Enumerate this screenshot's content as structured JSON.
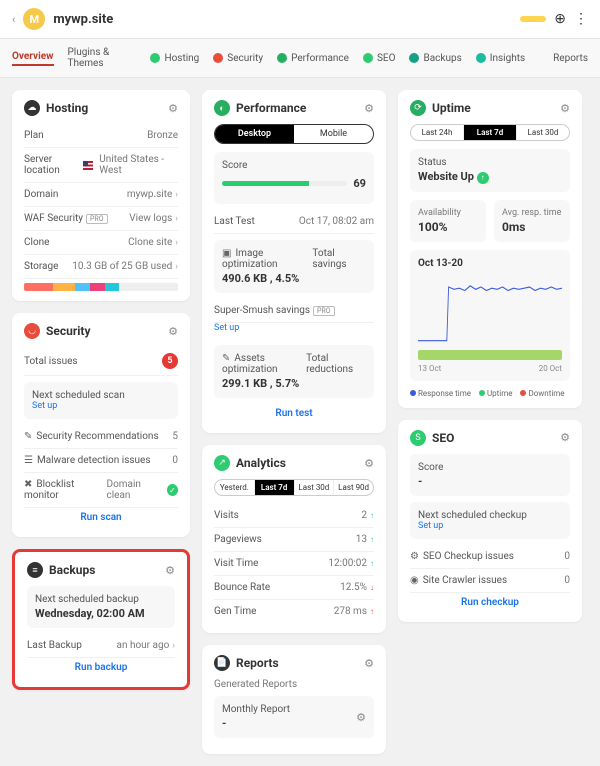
{
  "header": {
    "avatar": "M",
    "site": "mywp.site"
  },
  "tabs": {
    "overview": "Overview",
    "plugins": "Plugins & Themes",
    "hosting": "Hosting",
    "security": "Security",
    "performance": "Performance",
    "seo": "SEO",
    "backups": "Backups",
    "insights": "Insights",
    "reports": "Reports"
  },
  "hosting": {
    "title": "Hosting",
    "plan_l": "Plan",
    "plan_v": "Bronze",
    "loc_l": "Server location",
    "loc_v": "United States - West",
    "dom_l": "Domain",
    "dom_v": "mywp.site",
    "waf_l": "WAF Security",
    "waf_v": "View logs",
    "clone_l": "Clone",
    "clone_v": "Clone site",
    "stor_l": "Storage",
    "stor_v": "10.3 GB of 25 GB used"
  },
  "security": {
    "title": "Security",
    "issues_l": "Total issues",
    "issues_v": "5",
    "scan_l": "Next scheduled scan",
    "setup": "Set up",
    "rec_l": "Security Recommendations",
    "rec_v": "5",
    "mal_l": "Malware detection issues",
    "mal_v": "0",
    "block_l": "Blocklist monitor",
    "block_v": "Domain clean",
    "run": "Run scan"
  },
  "backups": {
    "title": "Backups",
    "next_l": "Next scheduled backup",
    "next_v": "Wednesday, 02:00 AM",
    "last_l": "Last Backup",
    "last_v": "an hour ago",
    "run": "Run backup"
  },
  "perf": {
    "title": "Performance",
    "desktop": "Desktop",
    "mobile": "Mobile",
    "score_l": "Score",
    "score_v": "69",
    "test_l": "Last Test",
    "test_v": "Oct 17, 08:02 am",
    "img_l": "Image optimization",
    "img_v": "490.6 KB , 4.5%",
    "img_r": "Total savings",
    "smush_l": "Super-Smush savings",
    "asset_l": "Assets optimization",
    "asset_v": "299.1 KB , 5.7%",
    "asset_r": "Total reductions",
    "run": "Run test",
    "setup": "Set up"
  },
  "analytics": {
    "title": "Analytics",
    "y": "Yesterd.",
    "l7": "Last 7d",
    "l30": "Last 30d",
    "l90": "Last 90d",
    "visits_l": "Visits",
    "visits_v": "2",
    "pv_l": "Pageviews",
    "pv_v": "13",
    "vt_l": "Visit Time",
    "vt_v": "12:00:02",
    "br_l": "Bounce Rate",
    "br_v": "12.5%",
    "gt_l": "Gen Time",
    "gt_v": "278 ms"
  },
  "reports": {
    "title": "Reports",
    "gen_l": "Generated Reports",
    "mr_l": "Monthly Report",
    "mr_v": "-"
  },
  "uptime": {
    "title": "Uptime",
    "l24": "Last 24h",
    "l7": "Last 7d",
    "l30": "Last 30d",
    "status_l": "Status",
    "status_v": "Website Up",
    "avail_l": "Availability",
    "avail_v": "100%",
    "resp_l": "Avg. resp. time",
    "resp_v": "0ms",
    "range": "Oct 13-20",
    "x1": "13 Oct",
    "x2": "20 Oct",
    "leg_rt": "Response time",
    "leg_up": "Uptime",
    "leg_dt": "Downtime"
  },
  "seo": {
    "title": "SEO",
    "score_l": "Score",
    "score_v": "-",
    "next_l": "Next scheduled checkup",
    "setup": "Set up",
    "chk_l": "SEO Checkup issues",
    "chk_v": "0",
    "crawl_l": "Site Crawler issues",
    "crawl_v": "0",
    "run": "Run checkup"
  },
  "chart_data": {
    "type": "line",
    "title": "Oct 13-20",
    "xlabel": "",
    "ylabel": "",
    "series": [
      {
        "name": "Response time",
        "values": [
          0,
          0,
          0,
          0,
          0,
          220,
          230,
          225,
          215,
          235,
          220,
          228,
          222,
          230,
          218,
          225,
          232,
          220,
          226,
          224,
          230
        ]
      }
    ],
    "x": [
      "13 Oct",
      "",
      "",
      "",
      "",
      "",
      "",
      "",
      "",
      "",
      "",
      "",
      "",
      "",
      "",
      "",
      "",
      "",
      "",
      "",
      "20 Oct"
    ],
    "ylim": [
      0,
      260
    ]
  }
}
